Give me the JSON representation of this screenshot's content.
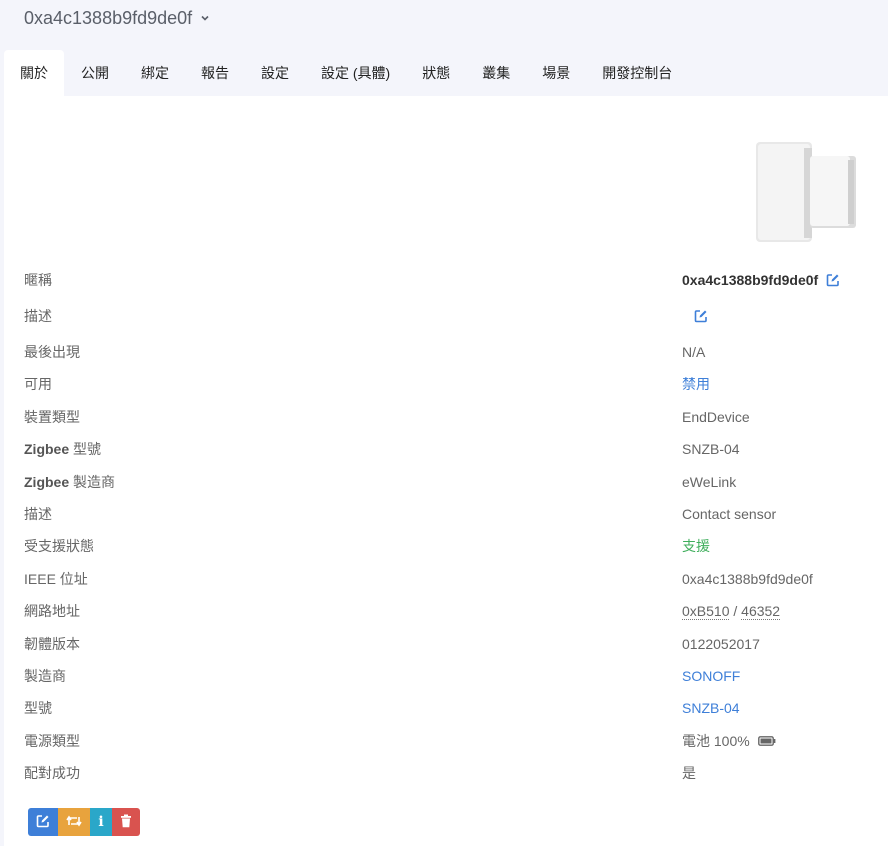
{
  "header": {
    "title": "0xa4c1388b9fd9de0f"
  },
  "tabs": [
    "關於",
    "公開",
    "綁定",
    "報告",
    "設定",
    "設定 (具體)",
    "狀態",
    "叢集",
    "場景",
    "開發控制台"
  ],
  "rows": {
    "nickname": {
      "label": "暱稱",
      "value": "0xa4c1388b9fd9de0f"
    },
    "description_edit": {
      "label": "描述"
    },
    "last_seen": {
      "label": "最後出現",
      "value": "N/A"
    },
    "availability": {
      "label": "可用",
      "value": "禁用"
    },
    "device_type": {
      "label": "裝置類型",
      "value": "EndDevice"
    },
    "zigbee_model": {
      "label_bold": "Zigbee",
      "label_rest": " 型號",
      "value": "SNZB-04"
    },
    "zigbee_manufacturer": {
      "label_bold": "Zigbee",
      "label_rest": " 製造商",
      "value": "eWeLink"
    },
    "description": {
      "label": "描述",
      "value": "Contact sensor"
    },
    "support_status": {
      "label": "受支援狀態",
      "value": "支援"
    },
    "ieee_address": {
      "label": "IEEE 位址",
      "value": "0xa4c1388b9fd9de0f"
    },
    "network_address": {
      "label": "網路地址",
      "value_hex": "0xB510",
      "separator": " / ",
      "value_dec": "46352"
    },
    "firmware": {
      "label": "韌體版本",
      "value": "0122052017"
    },
    "manufacturer": {
      "label": "製造商",
      "value": "SONOFF"
    },
    "model": {
      "label": "型號",
      "value": "SNZB-04"
    },
    "power": {
      "label": "電源類型",
      "value": "電池 100%"
    },
    "interview": {
      "label": "配對成功",
      "value": "是"
    }
  },
  "colors": {
    "link": "#3e7fd8",
    "green": "#3fae5c",
    "edit": "#3e7fd8",
    "rename": "#e8a33d",
    "info": "#2aa7c9",
    "delete": "#d9534f"
  },
  "actions": {
    "edit_icon": "edit-icon",
    "rename_icon": "swap-icon",
    "info_icon": "info-icon",
    "delete_icon": "trash-icon",
    "info_glyph": "i"
  }
}
